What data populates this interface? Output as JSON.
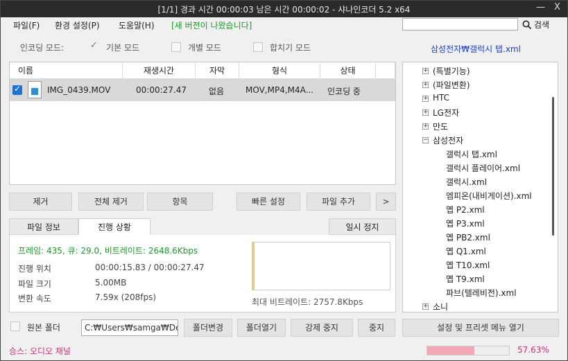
{
  "window": {
    "title": "[1/1] 경과 시간 00:00:03   남은 시간 00:00:02 - 샤나인코더 5.2 x64",
    "minimize": "—",
    "close": "X"
  },
  "menu": {
    "file": "파일(F)",
    "settings": "환경 설정(P)",
    "help": "도움말(H)",
    "notice": "[새 버전이 나왔습니다]"
  },
  "search": {
    "value": "",
    "button_label": "검색"
  },
  "mode": {
    "label": "인코딩 모드:",
    "basic": "기본 모드",
    "individual": "개별 모드",
    "merge": "합치기 모드"
  },
  "profile_link": "삼성전자₩갤럭시 탭.xml",
  "file_table": {
    "headers": [
      "이름",
      "재생시간",
      "자막",
      "형식",
      "상태"
    ],
    "rows": [
      {
        "name": "IMG_0439.MOV",
        "duration": "00:00:27.47",
        "subtitle": "없음",
        "format": "MOV,MP4,M4A...",
        "status": "인코딩 중"
      }
    ]
  },
  "list_buttons": {
    "remove": "제거",
    "remove_all": "전체 제거",
    "item": "항목",
    "quick_settings": "빠른 설정",
    "add_file": "파일 추가",
    "more": ">"
  },
  "tabs": {
    "file_info": "파일 정보",
    "progress": "진행 상황",
    "pause": "일시 정지"
  },
  "progress": {
    "stats": "프레임: 435, 큐: 29.0, 비트레이트: 2648.6Kbps",
    "position_label": "진행 위치",
    "position_value": "00:00:15.83  /  00:00:27.47",
    "size_label": "파일 크기",
    "size_value": "5.00MB",
    "speed_label": "변환 속도",
    "speed_value": "7.59x (208fps)",
    "max_bitrate": "최대 비트레이트: 2757.8Kbps"
  },
  "tree": [
    {
      "label": "(특별기능)",
      "expander": "+"
    },
    {
      "label": "(파일변환)",
      "expander": "+"
    },
    {
      "label": "HTC",
      "expander": "+"
    },
    {
      "label": "LG전자",
      "expander": "+"
    },
    {
      "label": "만도",
      "expander": "+"
    },
    {
      "label": "삼성전자",
      "expander": "−"
    },
    {
      "label": "갤럭시 탭.xml",
      "child": true
    },
    {
      "label": "갤럭시 플레이어.xml",
      "child": true
    },
    {
      "label": "갤럭시.xml",
      "child": true
    },
    {
      "label": "엠피온(내비게이션).xml",
      "child": true
    },
    {
      "label": "옙 P2.xml",
      "child": true
    },
    {
      "label": "옙 P3.xml",
      "child": true
    },
    {
      "label": "옙 PB2.xml",
      "child": true
    },
    {
      "label": "옙 Q1.xml",
      "child": true
    },
    {
      "label": "옙 T10.xml",
      "child": true
    },
    {
      "label": "옙 T9.xml",
      "child": true
    },
    {
      "label": "파브(텔레비전).xml",
      "child": true
    },
    {
      "label": "소니",
      "expander": "+"
    }
  ],
  "bottom": {
    "source_folder": "원본 폴더",
    "path": "C:₩Users₩samga₩De",
    "change_folder": "폴더변경",
    "open_folder": "폴더열기",
    "force_stop": "강제 중지",
    "stop": "중지",
    "settings_menu": "설정 및 프리셋 메뉴 열기"
  },
  "status": {
    "text": "승스: 오디오 채널",
    "percent_label": "57.63%",
    "progress_fraction": 0.5763
  },
  "colors": {
    "accent_green": "#1a9a2a",
    "link_blue": "#1a3fd6",
    "status_pink": "#d42d7a"
  }
}
